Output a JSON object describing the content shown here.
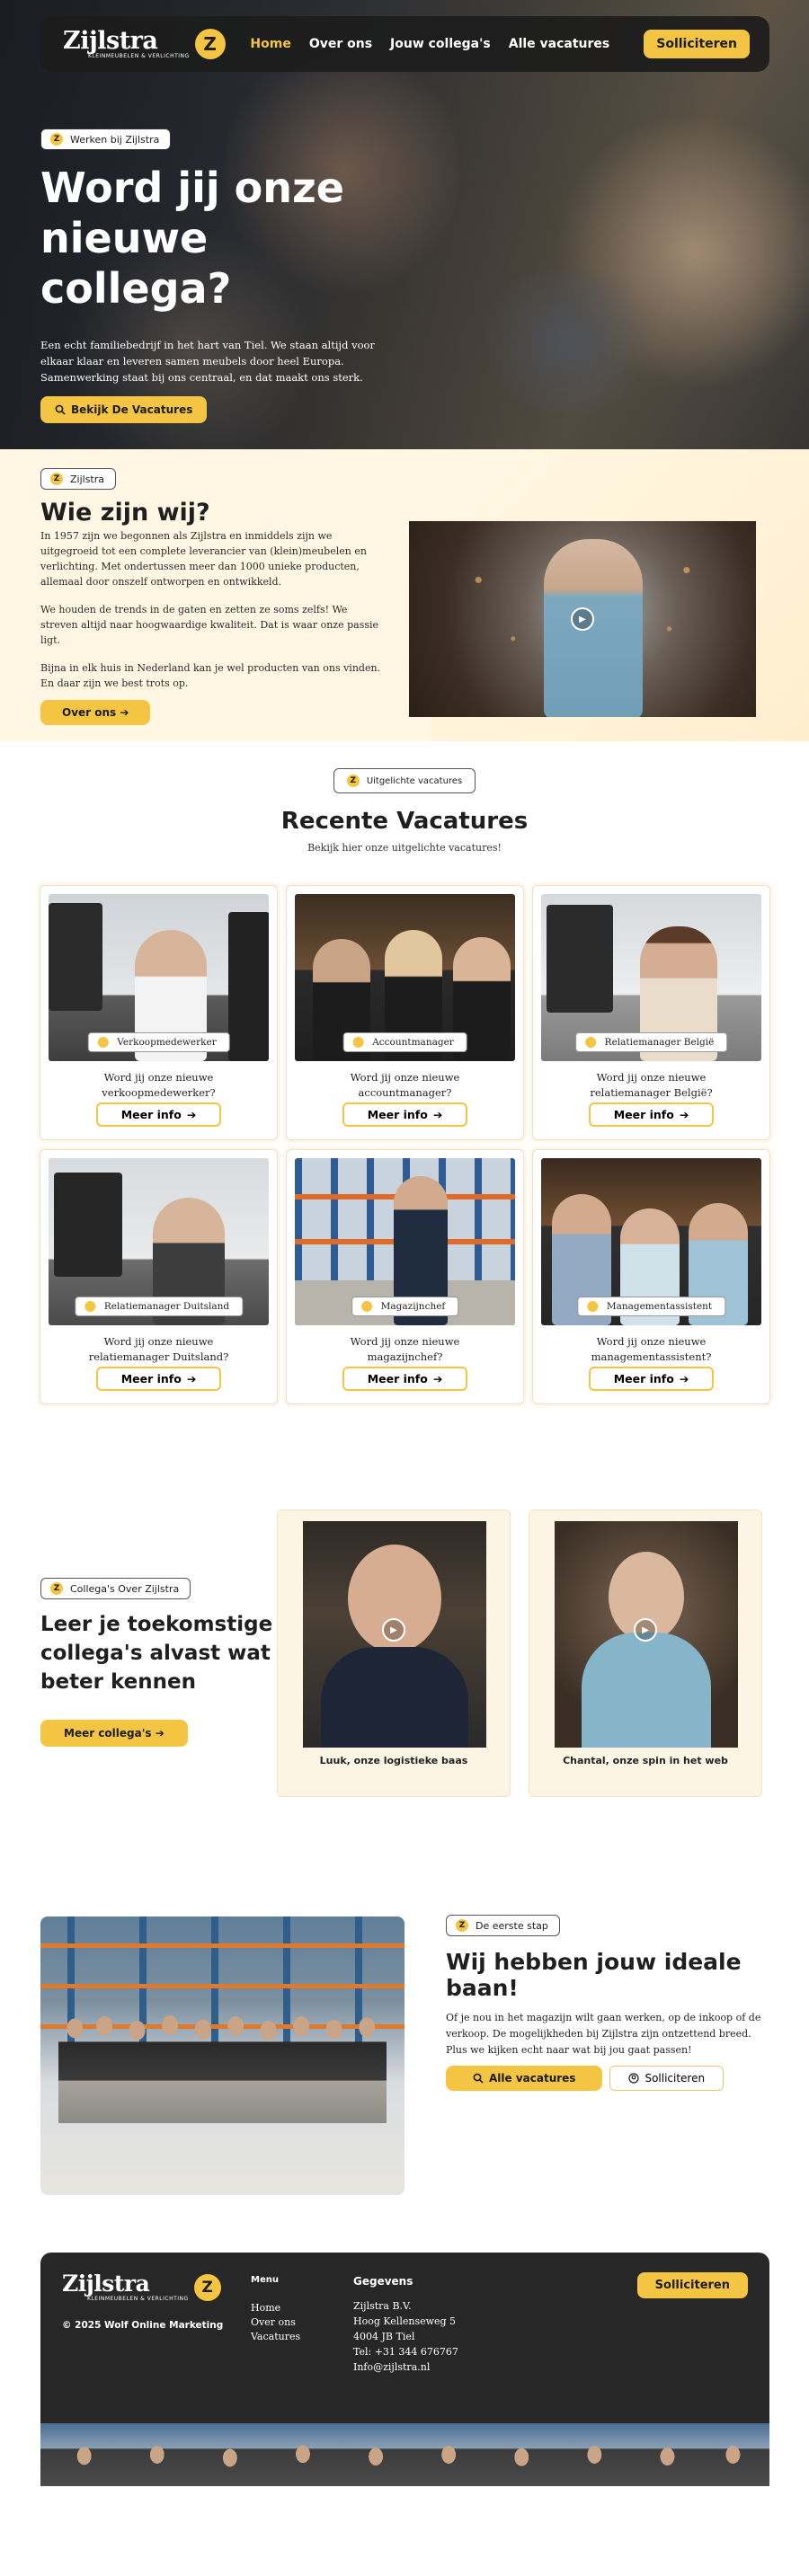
{
  "colors": {
    "accent": "#f4c542",
    "dark": "#272727",
    "cream": "#fff7e4"
  },
  "brand": {
    "name": "Zijlstra",
    "tagline": "KLEINMEUBELEN & VERLICHTING",
    "badge": "Z"
  },
  "nav": {
    "items": [
      "Home",
      "Over ons",
      "Jouw collega's",
      "Alle vacatures"
    ],
    "active": "Home",
    "apply_label": "Solliciteren"
  },
  "hero": {
    "pill": "Werken bij Zijlstra",
    "title": "Word jij onze nieuwe collega?",
    "text": "Een echt familiebedrijf in het hart van Tiel. We staan altijd voor elkaar klaar en leveren samen meubels door heel Europa. Samenwerking staat bij ons centraal, en dat maakt ons sterk.",
    "cta": "Bekijk De Vacatures"
  },
  "about": {
    "pill": "Zijlstra",
    "title": "Wie zijn wij?",
    "paragraphs": [
      "In 1957 zijn we begonnen als Zijlstra en inmiddels zijn we uitgegroeid tot een complete leverancier van (klein)meubelen en verlichting. Met ondertussen meer dan 1000 unieke producten, allemaal door onszelf ontworpen en ontwikkeld.",
      "We houden de trends in de gaten en zetten ze soms zelfs! We streven altijd naar hoogwaardige kwaliteit. Dat is waar onze passie ligt.",
      "Bijna in elk huis in Nederland kan je wel producten van ons vinden. En daar zijn we best trots op."
    ],
    "cta": "Over ons"
  },
  "vacatures": {
    "pill": "Uitgelichte vacatures",
    "title": "Recente Vacatures",
    "subtitle": "Bekijk hier onze uitgelichte vacatures!",
    "more_label": "Meer info",
    "cards": [
      {
        "tag": "Verkoopmedewerker",
        "question": "Word jij onze nieuwe verkoopmedewerker?"
      },
      {
        "tag": "Accountmanager",
        "question": "Word jij onze nieuwe accountmanager?"
      },
      {
        "tag": "Relatiemanager België",
        "question": "Word jij onze nieuwe relatiemanager België?"
      },
      {
        "tag": "Relatiemanager Duitsland",
        "question": "Word jij onze nieuwe relatiemanager Duitsland?"
      },
      {
        "tag": "Magazijnchef",
        "question": "Word jij onze nieuwe magazijnchef?"
      },
      {
        "tag": "Managementassistent",
        "question": "Word jij onze nieuwe managementassistent?"
      }
    ]
  },
  "collegas": {
    "pill": "Collega's Over Zijlstra",
    "title": "Leer je toekomstige collega's alvast wat beter kennen",
    "cta": "Meer collega's",
    "videos": [
      {
        "caption": "Luuk, onze logistieke baas"
      },
      {
        "caption": "Chantal, onze spin in het web"
      }
    ]
  },
  "ideal": {
    "pill": "De eerste stap",
    "title": "Wij hebben jouw ideale baan!",
    "text": "Of je nou in het magazijn wilt gaan werken, op de inkoop of de verkoop. De mogelijkheden bij Zijlstra zijn ontzettend breed. Plus we kijken echt naar wat bij jou gaat passen!",
    "btn_primary": "Alle vacatures",
    "btn_secondary": "Solliciteren"
  },
  "footer": {
    "copyright": "© 2025 Wolf Online Marketing",
    "menu_title": "Menu",
    "menu_items": [
      "Home",
      "Over ons",
      "Vacatures"
    ],
    "contact_title": "Gegevens",
    "contact_lines": [
      "Zijlstra B.V.",
      "Hoog Kellenseweg 5",
      "4004 JB Tiel",
      "Tel: +31 344 676767",
      "Info@zijlstra.nl"
    ],
    "apply_label": "Solliciteren"
  }
}
